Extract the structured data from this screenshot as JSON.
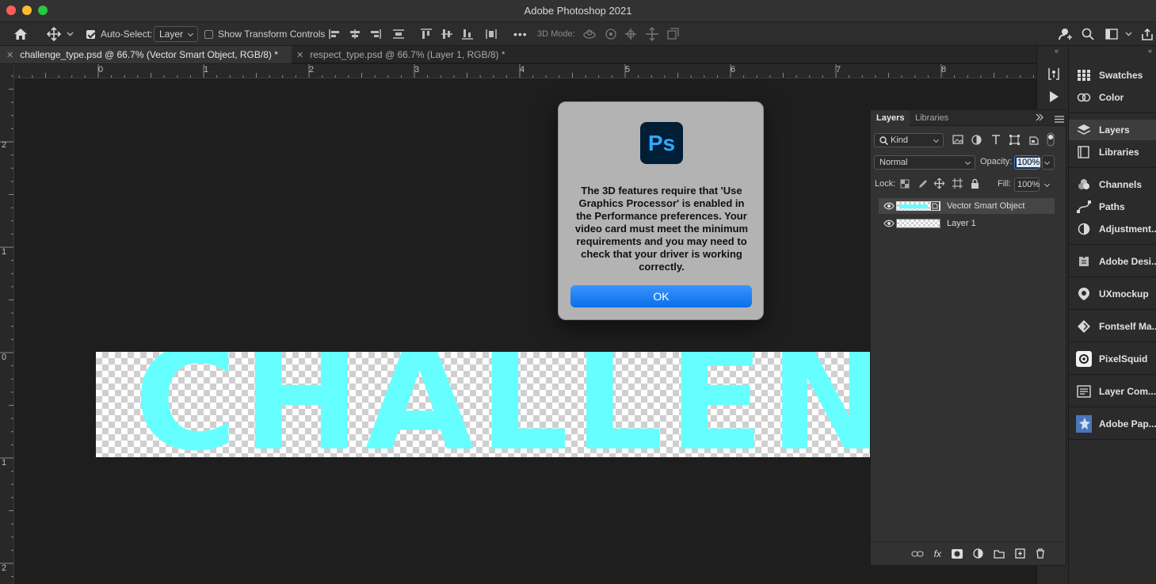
{
  "window": {
    "title": "Adobe Photoshop 2021"
  },
  "options_bar": {
    "auto_select_label": "Auto-Select:",
    "auto_select_value": "Layer",
    "show_transform_label": "Show Transform Controls",
    "mode_3d_label": "3D Mode:",
    "more_label": "•••"
  },
  "tabs": [
    {
      "label": "challenge_type.psd @ 66.7% (Vector Smart Object, RGB/8) *",
      "active": true
    },
    {
      "label": "respect_type.psd @ 66.7% (Layer 1, RGB/8) *",
      "active": false
    }
  ],
  "rulers": {
    "horizontal": [
      "0",
      "1",
      "2",
      "3",
      "4",
      "5",
      "6",
      "7",
      "8"
    ],
    "vertical": [
      "2",
      "1",
      "0",
      "1",
      "2"
    ]
  },
  "canvas": {
    "document_text": "CHALLENGE",
    "text_color": "#66ffff"
  },
  "dialog": {
    "message": "The 3D features require that 'Use Graphics Processor' is enabled in the Performance preferences. Your video card must meet the minimum requirements and you may need to check that your driver is working correctly.",
    "ok_label": "OK",
    "logo_text": "Ps",
    "logo_color": "#31a8ff"
  },
  "layers_panel": {
    "tabs": [
      "Layers",
      "Libraries"
    ],
    "filter_kind": "Kind",
    "blend_mode": "Normal",
    "opacity_label": "Opacity:",
    "opacity_value": "100%",
    "lock_label": "Lock:",
    "fill_label": "Fill:",
    "fill_value": "100%",
    "layers": [
      {
        "name": "Vector Smart Object",
        "selected": true
      },
      {
        "name": "Layer 1",
        "selected": false
      }
    ]
  },
  "right_panels": [
    {
      "label": "Swatches",
      "icon": "swatches-icon"
    },
    {
      "label": "Color",
      "icon": "color-icon"
    },
    {
      "label": "Layers",
      "icon": "layers-icon",
      "active": true
    },
    {
      "label": "Libraries",
      "icon": "libraries-icon"
    },
    {
      "label": "Channels",
      "icon": "channels-icon"
    },
    {
      "label": "Paths",
      "icon": "paths-icon"
    },
    {
      "label": "Adjustment...",
      "icon": "adjustments-icon"
    },
    {
      "label": "Adobe Desi...",
      "icon": "adobe-design-icon"
    },
    {
      "label": "UXmockup",
      "icon": "uxmockup-icon"
    },
    {
      "label": "Fontself Ma...",
      "icon": "fontself-icon"
    },
    {
      "label": "PixelSquid",
      "icon": "pixelsquid-icon"
    },
    {
      "label": "Layer Com...",
      "icon": "layer-comps-icon"
    },
    {
      "label": "Adobe Pap...",
      "icon": "adobe-paper-icon"
    }
  ]
}
